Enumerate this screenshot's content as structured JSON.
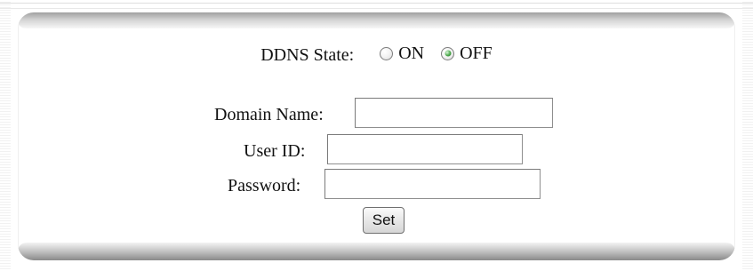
{
  "ddns": {
    "label": "DDNS State:",
    "options": [
      {
        "label": "ON",
        "selected": false
      },
      {
        "label": "OFF",
        "selected": true
      }
    ]
  },
  "form": {
    "domain_name": {
      "label": "Domain Name:",
      "value": "",
      "placeholder": ""
    },
    "user_id": {
      "label": "User ID:",
      "value": "",
      "placeholder": ""
    },
    "password": {
      "label": "Password:",
      "value": "",
      "placeholder": ""
    }
  },
  "actions": {
    "set_label": "Set"
  },
  "colors": {
    "radio_checked_accent": "#4aa84a",
    "panel_edge_dark": "#8a8a8a"
  },
  "icons": {
    "radio_unchecked": "radio-unchecked-icon",
    "radio_checked": "radio-checked-icon"
  }
}
